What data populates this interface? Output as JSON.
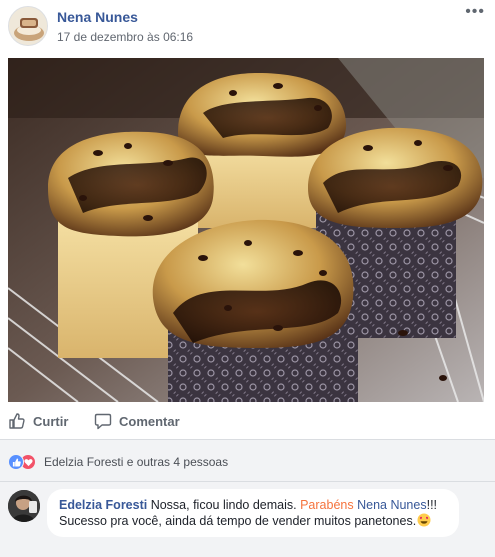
{
  "post": {
    "author": "Nena Nunes",
    "timestamp": "17 de dezembro às 06:16",
    "more_label": "•••"
  },
  "photo": {
    "subject": "panettones"
  },
  "actions": {
    "like_label": "Curtir",
    "comment_label": "Comentar"
  },
  "reactions": {
    "summary": "Edelzia Foresti e outras 4 pessoas",
    "types": [
      "like",
      "love"
    ]
  },
  "comment": {
    "author": "Edelzia Foresti",
    "text_part1": " Nossa, ficou lindo demais. ",
    "highlight": "Parabéns",
    "space": " ",
    "mention": "Nena Nunes",
    "text_part2": "!!! Sucesso pra você, ainda dá tempo de vender muitos panetones."
  },
  "colors": {
    "link_blue": "#385898",
    "like_blue": "#5890ff",
    "love_red": "#f25268",
    "highlight_orange": "#f5733d",
    "muted_gray": "#606770"
  }
}
